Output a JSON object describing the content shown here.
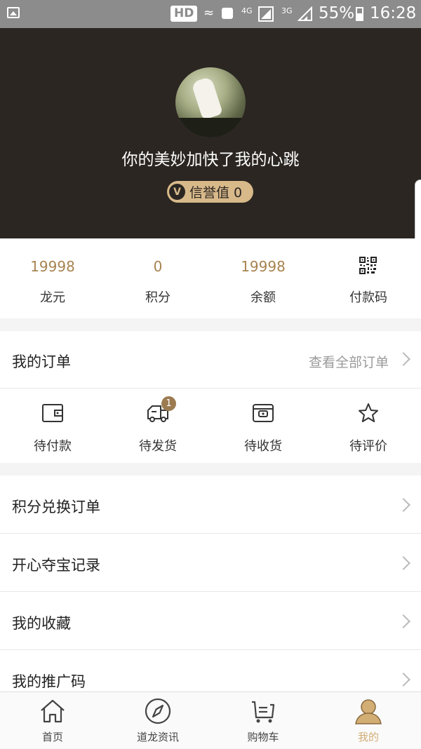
{
  "status_bar": {
    "hd": "HD",
    "net1": "4G",
    "net2": "3G",
    "battery": "55%",
    "time": "16:28"
  },
  "profile": {
    "nickname": "你的美妙加快了我的心跳",
    "credit_label": "信誉值 0",
    "credit_icon_glyph": "V"
  },
  "stats": [
    {
      "value": "19998",
      "label": "龙元"
    },
    {
      "value": "0",
      "label": "积分"
    },
    {
      "value": "19998",
      "label": "余额"
    },
    {
      "label": "付款码",
      "icon": "qr-code-icon"
    }
  ],
  "orders": {
    "title": "我的订单",
    "view_all": "查看全部订单",
    "items": [
      {
        "label": "待付款",
        "icon": "wallet-icon"
      },
      {
        "label": "待发货",
        "icon": "truck-icon",
        "badge": "1"
      },
      {
        "label": "待收货",
        "icon": "box-icon"
      },
      {
        "label": "待评价",
        "icon": "star-icon"
      }
    ]
  },
  "menu": [
    {
      "label": "积分兑换订单"
    },
    {
      "label": "开心夺宝记录"
    },
    {
      "label": "我的收藏"
    },
    {
      "label": "我的推广码"
    }
  ],
  "bottom_nav": {
    "active": "我的",
    "items": [
      {
        "label": "首页",
        "icon": "home-icon"
      },
      {
        "label": "道龙资讯",
        "icon": "compass-icon"
      },
      {
        "label": "购物车",
        "icon": "cart-icon"
      },
      {
        "label": "我的",
        "icon": "user-icon"
      }
    ]
  },
  "colors": {
    "header_bg": "#2b2622",
    "accent_gold": "#d2ad74",
    "stat_value": "#a78350"
  }
}
